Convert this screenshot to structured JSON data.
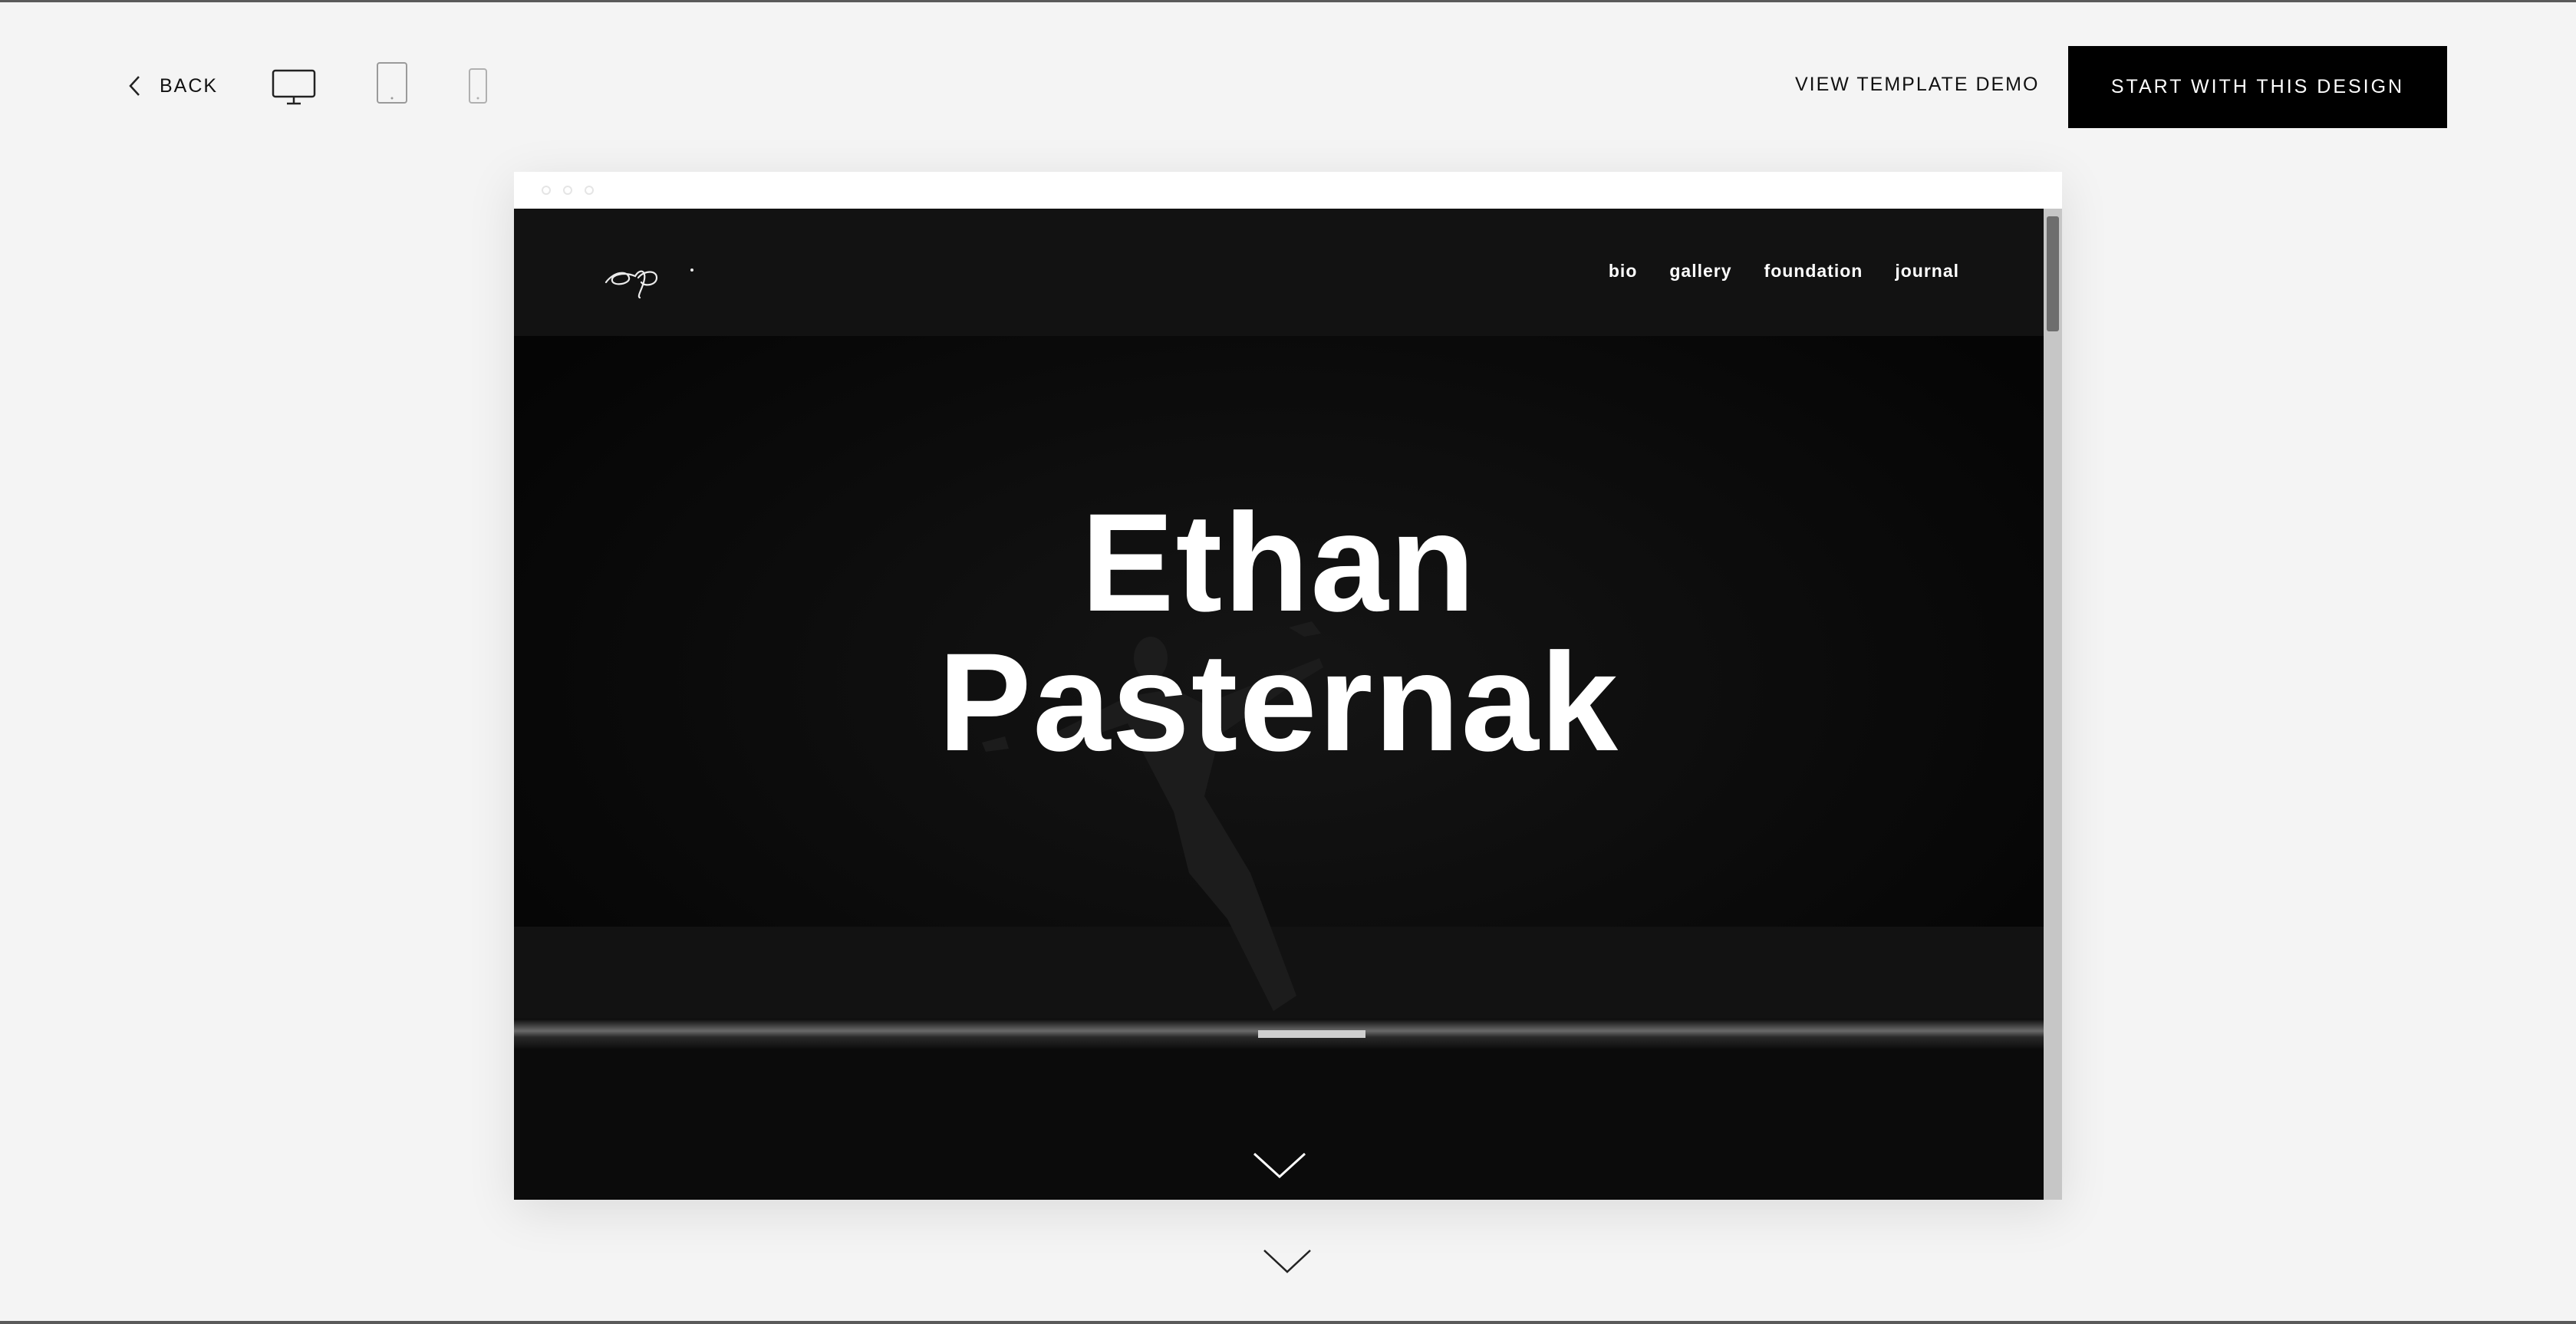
{
  "topbar": {
    "back_label": "BACK",
    "devices": [
      {
        "name": "desktop",
        "icon": "desktop-icon",
        "selected": true
      },
      {
        "name": "tablet",
        "icon": "tablet-icon",
        "selected": false
      },
      {
        "name": "mobile",
        "icon": "mobile-icon",
        "selected": false
      }
    ],
    "demo_label": "VIEW TEMPLATE DEMO",
    "cta_label": "START WITH THIS DESIGN"
  },
  "preview": {
    "logo_text": "ep.",
    "nav": [
      "bio",
      "gallery",
      "foundation",
      "journal"
    ],
    "hero": {
      "title_line1": "Ethan",
      "title_line2": "Pasternak"
    }
  },
  "colors": {
    "page_bg": "#f4f4f4",
    "cta_bg": "#000000",
    "cta_text": "#ffffff",
    "site_header_bg": "#121212",
    "hero_bg": "#070707"
  }
}
